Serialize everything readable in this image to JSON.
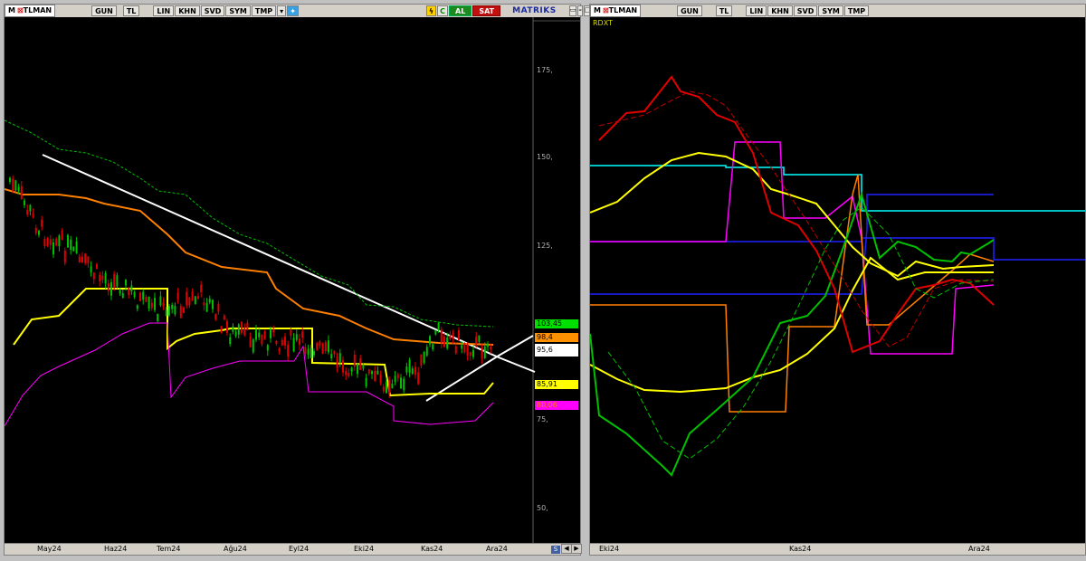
{
  "left_window": {
    "toolbar": {
      "logo_m": "M",
      "logo_rest": "TLMAN",
      "buttons": [
        "GUN",
        "TL",
        "LIN",
        "KHN",
        "SVD",
        "SYM",
        "TMP"
      ],
      "al_label": "AL",
      "sat_label": "SAT",
      "brand": "MATRIKS"
    },
    "y_labels": [
      "175,",
      "150,",
      "125,",
      "75,",
      "50,"
    ],
    "price_boxes": [
      {
        "text": "103,45",
        "bg": "#00e000"
      },
      {
        "text": "98,4",
        "bg": "#ff9000"
      },
      {
        "text": "95,6",
        "bg": "#ffffff"
      },
      {
        "text": "85,91",
        "bg": "#ffff00"
      },
      {
        "text": "80,06",
        "bg": "#ff00ff"
      }
    ],
    "x_labels": [
      "May24",
      "Haz24",
      "Tem24",
      "Ağu24",
      "Eyl24",
      "Eki24",
      "Kas24",
      "Ara24"
    ]
  },
  "right_window": {
    "toolbar": {
      "logo_m": "M",
      "logo_rest": "TLMAN",
      "buttons": [
        "GUN",
        "TL",
        "LIN",
        "KHN",
        "SVD",
        "SYM",
        "TMP"
      ]
    },
    "indicator_label": "RDXT",
    "x_labels": [
      "Eki24",
      "Kas24",
      "Ara24"
    ]
  },
  "colors": {
    "background": "#000000",
    "toolbar": "#d4d0c8",
    "price_up": "#00c000",
    "price_down": "#e00000",
    "orange_band": "#ff8000",
    "green_band": "#00c000",
    "yellow_band": "#ffff00",
    "magenta_band": "#ff00ff",
    "trendline": "#ffffff",
    "cyan": "#00ffff",
    "blue": "#2020ff"
  }
}
